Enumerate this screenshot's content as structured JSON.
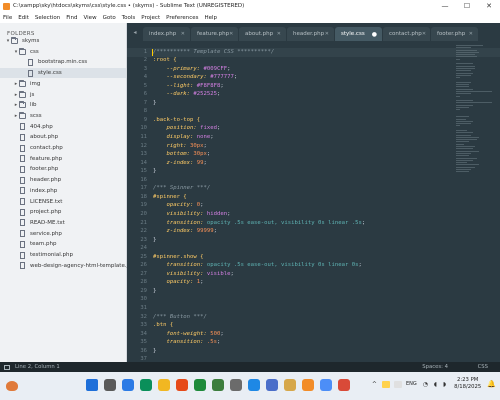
{
  "window": {
    "title": "C:\\xampp\\sky\\htdocs\\skyms\\css\\style.css • (skyms) - Sublime Text (UNREGISTERED)",
    "controls": {
      "minimize": "—",
      "maximize": "☐",
      "close": "✕"
    }
  },
  "menu": [
    "File",
    "Edit",
    "Selection",
    "Find",
    "View",
    "Goto",
    "Tools",
    "Project",
    "Preferences",
    "Help"
  ],
  "sidebar": {
    "title": "FOLDERS",
    "tree": [
      {
        "label": "skyms",
        "kind": "folder",
        "expanded": true,
        "depth": 0
      },
      {
        "label": "css",
        "kind": "folder",
        "expanded": true,
        "depth": 1
      },
      {
        "label": "bootstrap.min.css",
        "kind": "file",
        "depth": 2
      },
      {
        "label": "style.css",
        "kind": "file",
        "depth": 2,
        "active": true
      },
      {
        "label": "img",
        "kind": "folder",
        "expanded": false,
        "depth": 1
      },
      {
        "label": "js",
        "kind": "folder",
        "expanded": false,
        "depth": 1
      },
      {
        "label": "lib",
        "kind": "folder",
        "expanded": false,
        "depth": 1
      },
      {
        "label": "scss",
        "kind": "folder",
        "expanded": false,
        "depth": 1
      },
      {
        "label": "404.php",
        "kind": "file",
        "depth": 1
      },
      {
        "label": "about.php",
        "kind": "file",
        "depth": 1
      },
      {
        "label": "contact.php",
        "kind": "file",
        "depth": 1
      },
      {
        "label": "feature.php",
        "kind": "file",
        "depth": 1
      },
      {
        "label": "footer.php",
        "kind": "file",
        "depth": 1
      },
      {
        "label": "header.php",
        "kind": "file",
        "depth": 1
      },
      {
        "label": "index.php",
        "kind": "file",
        "depth": 1
      },
      {
        "label": "LICENSE.txt",
        "kind": "file",
        "depth": 1
      },
      {
        "label": "project.php",
        "kind": "file",
        "depth": 1
      },
      {
        "label": "READ-ME.txt",
        "kind": "file",
        "depth": 1
      },
      {
        "label": "service.php",
        "kind": "file",
        "depth": 1
      },
      {
        "label": "team.php",
        "kind": "file",
        "depth": 1
      },
      {
        "label": "testimonial.php",
        "kind": "file",
        "depth": 1
      },
      {
        "label": "web-design-agency-html-template.jpg",
        "kind": "file",
        "depth": 1
      }
    ]
  },
  "tabs": {
    "nav_prev": "◂",
    "nav_next": "▸",
    "items": [
      {
        "label": "index.php",
        "close": "✕"
      },
      {
        "label": "feature.php",
        "close": "✕"
      },
      {
        "label": "about.php",
        "close": "✕"
      },
      {
        "label": "header.php",
        "close": "✕"
      },
      {
        "label": "style.css",
        "close": "●",
        "active": true
      },
      {
        "label": "contact.php",
        "close": "✕"
      },
      {
        "label": "footer.php",
        "close": "✕"
      }
    ]
  },
  "editor": {
    "line_numbers": [
      "1",
      "2",
      "3",
      "4",
      "5",
      "6",
      "7",
      "8",
      "9",
      "10",
      "11",
      "12",
      "13",
      "14",
      "15",
      "16",
      "17",
      "18",
      "19",
      "20",
      "21",
      "22",
      "23",
      "24",
      "25",
      "26",
      "27",
      "28",
      "29",
      "30",
      "31",
      "32",
      "33",
      "34",
      "35",
      "36",
      "37"
    ],
    "lines": [
      [
        [
          "",
          "/********** Template CSS **********/",
          "comment"
        ]
      ],
      [
        [
          ":root {",
          "sel"
        ]
      ],
      [
        [
          "    --primary: ",
          "prop"
        ],
        [
          "#009CFF",
          "val"
        ],
        [
          ";",
          "punc"
        ]
      ],
      [
        [
          "    --secondary: ",
          "prop"
        ],
        [
          "#777777",
          "val"
        ],
        [
          ";",
          "punc"
        ]
      ],
      [
        [
          "    --light: ",
          "prop"
        ],
        [
          "#F8F8F8",
          "val"
        ],
        [
          ";",
          "punc"
        ]
      ],
      [
        [
          "    --dark: ",
          "prop"
        ],
        [
          "#252525",
          "val"
        ],
        [
          ";",
          "punc"
        ]
      ],
      [
        [
          "}",
          "punc"
        ]
      ],
      [
        [
          "",
          "punc"
        ]
      ],
      [
        [
          ".back-to-top {",
          "sel"
        ]
      ],
      [
        [
          "    position: ",
          "prop"
        ],
        [
          "fixed",
          "val"
        ],
        [
          ";",
          "punc"
        ]
      ],
      [
        [
          "    display: ",
          "prop"
        ],
        [
          "none",
          "val"
        ],
        [
          ";",
          "punc"
        ]
      ],
      [
        [
          "    right: ",
          "prop"
        ],
        [
          "30px",
          "num"
        ],
        [
          ";",
          "punc"
        ]
      ],
      [
        [
          "    bottom: ",
          "prop"
        ],
        [
          "30px",
          "num"
        ],
        [
          ";",
          "punc"
        ]
      ],
      [
        [
          "    z-index: ",
          "prop"
        ],
        [
          "99",
          "num"
        ],
        [
          ";",
          "punc"
        ]
      ],
      [
        [
          "}",
          "punc"
        ]
      ],
      [
        [
          "",
          "punc"
        ]
      ],
      [
        [
          "/*** Spinner ***/",
          "comment"
        ]
      ],
      [
        [
          "#spinner {",
          "sel"
        ]
      ],
      [
        [
          "    opacity: ",
          "prop"
        ],
        [
          "0",
          "num"
        ],
        [
          ";",
          "punc"
        ]
      ],
      [
        [
          "    visibility: ",
          "prop"
        ],
        [
          "hidden",
          "val"
        ],
        [
          ";",
          "punc"
        ]
      ],
      [
        [
          "    transition: ",
          "prop"
        ],
        [
          "opacity .5s ease-out, visibility 0s linear .5s",
          "fn"
        ],
        [
          ";",
          "punc"
        ]
      ],
      [
        [
          "    z-index: ",
          "prop"
        ],
        [
          "99999",
          "num"
        ],
        [
          ";",
          "punc"
        ]
      ],
      [
        [
          "}",
          "punc"
        ]
      ],
      [
        [
          "",
          "punc"
        ]
      ],
      [
        [
          "#spinner.show {",
          "sel"
        ]
      ],
      [
        [
          "    transition: ",
          "prop"
        ],
        [
          "opacity .5s ease-out, visibility 0s linear 0s",
          "fn"
        ],
        [
          ";",
          "punc"
        ]
      ],
      [
        [
          "    visibility: ",
          "prop"
        ],
        [
          "visible",
          "val"
        ],
        [
          ";",
          "punc"
        ]
      ],
      [
        [
          "    opacity: ",
          "prop"
        ],
        [
          "1",
          "num"
        ],
        [
          ";",
          "punc"
        ]
      ],
      [
        [
          "}",
          "punc"
        ]
      ],
      [
        [
          "",
          "punc"
        ]
      ],
      [
        [
          "",
          "punc"
        ]
      ],
      [
        [
          "/*** Button ***/",
          "comment"
        ]
      ],
      [
        [
          ".btn {",
          "sel"
        ]
      ],
      [
        [
          "    font-weight: ",
          "prop"
        ],
        [
          "500",
          "num"
        ],
        [
          ";",
          "punc"
        ]
      ],
      [
        [
          "    transition: ",
          "prop"
        ],
        [
          ".5s",
          "num"
        ],
        [
          ";",
          "punc"
        ]
      ],
      [
        [
          "}",
          "punc"
        ]
      ],
      [
        [
          "",
          "punc"
        ]
      ]
    ]
  },
  "status": {
    "position": "Line 2, Column 1",
    "spaces": "Spaces: 4",
    "syntax": "CSS"
  },
  "taskbar": {
    "tray_arrow": "^",
    "lang": "ENG",
    "sys_icons": "◔ ◖ ◗",
    "time": "2:23 PM",
    "date": "8/18/2025",
    "bell": "🔔",
    "app_colors": [
      "#1e6fd9",
      "#5a5a5a",
      "#2c7be5",
      "#0a8f5a",
      "#f1b722",
      "#e64a19",
      "#1f8a3b",
      "#3d7d3d",
      "#6b6b6b",
      "#1e88e5",
      "#4b6ec9",
      "#d6a74a",
      "#f28c28",
      "#4c8ef7",
      "#d94a38"
    ],
    "tray_colors": [
      "#ffd24d",
      "#e0e0e0"
    ]
  }
}
